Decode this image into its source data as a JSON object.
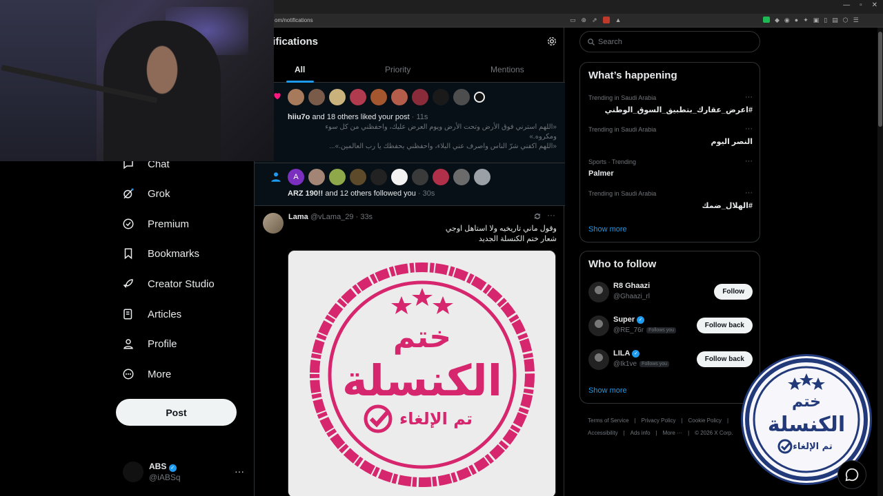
{
  "browser": {
    "url": "om/notifications",
    "window_controls": [
      "—",
      "▫",
      "✕"
    ]
  },
  "sidebar": {
    "items": [
      {
        "label": "Chat",
        "icon": "chat-icon"
      },
      {
        "label": "Grok",
        "icon": "grok-icon"
      },
      {
        "label": "Premium",
        "icon": "premium-icon"
      },
      {
        "label": "Bookmarks",
        "icon": "bookmark-icon"
      },
      {
        "label": "Creator Studio",
        "icon": "rocket-icon"
      },
      {
        "label": "Articles",
        "icon": "articles-icon"
      },
      {
        "label": "Profile",
        "icon": "person-icon"
      },
      {
        "label": "More",
        "icon": "more-circle-icon"
      }
    ],
    "post_label": "Post",
    "account": {
      "name": "ABS",
      "handle": "@iABSq",
      "more": "···"
    }
  },
  "main": {
    "title": "otifications",
    "tabs": [
      {
        "label": "All",
        "active": true
      },
      {
        "label": "Priority",
        "active": false
      },
      {
        "label": "Mentions",
        "active": false
      }
    ],
    "liked": {
      "user": "hiiu7o",
      "rest": " and 18 others liked your post",
      "time": " · 11s",
      "body_line1": "«اللهم استرني فوق الأرض وتحت الأرض ويوم العرض عليك، واحفظني من كل سوء",
      "body_line2": "ومكروه.»",
      "body_line3": "«اللهم اكفني شرّ الناس واصرف عني البلاء، واحفظني بحفظك يا رب العالمين.»..."
    },
    "followed": {
      "user": "ARZ 190!!",
      "rest": " and 12 others followed you",
      "time": " · 30s",
      "first_avatar_letter": "A"
    },
    "tweet": {
      "name": "Lama",
      "handle": "@vLama_29",
      "time": " · 33s",
      "more": "···",
      "line1": "وقول ماني تاريخيه ولا استاهل اوجي",
      "line2": "شعار ختم الكنسلة الجديد",
      "stamp_top": "ختم",
      "stamp_main": "الكنسلة",
      "stamp_bottom": "تم الإلغاء"
    }
  },
  "right": {
    "search_placeholder": "Search",
    "happening_title": "What’s happening",
    "trends": [
      {
        "context": "Trending in Saudi Arabia",
        "name": "#اعرض_عقارك_بتطبيق_السوق_الوطني",
        "rtl": true
      },
      {
        "context": "Trending in Saudi Arabia",
        "name": "النصر اليوم",
        "rtl": true
      },
      {
        "context": "Sports · Trending",
        "name": "Palmer",
        "rtl": false
      },
      {
        "context": "Trending in Saudi Arabia",
        "name": "#الهلال_ضمك",
        "rtl": true
      }
    ],
    "trend_more": "···",
    "show_more": "Show more",
    "follow_title": "Who to follow",
    "follow": [
      {
        "name": "R8 Ghaazi",
        "handle": "@Ghaazi_rl",
        "verified": false,
        "follows_you": "",
        "button": "Follow"
      },
      {
        "name": "Super",
        "handle": "@RE_76r",
        "verified": true,
        "follows_you": "Follows you",
        "button": "Follow back"
      },
      {
        "name": "LILA",
        "handle": "@Ik1ve",
        "verified": true,
        "follows_you": "Follows you",
        "button": "Follow back"
      }
    ],
    "follow_show_more": "Show more",
    "footer": [
      "Terms of Service",
      "|",
      "Privacy Policy",
      "|",
      "Cookie Policy",
      "|",
      "Accessibility",
      "|",
      "Ads info",
      "|",
      "More ···",
      "|",
      "© 2026 X Corp."
    ]
  },
  "overlay_stamp": {
    "top": "ختم",
    "main": "الكنسلة",
    "bottom": "تم الإلغاء"
  },
  "colors": {
    "accent": "#1d9bf0",
    "stamp_pink": "#d6266d",
    "stamp_blue": "#223a7a",
    "unread_bg": "#061016"
  }
}
